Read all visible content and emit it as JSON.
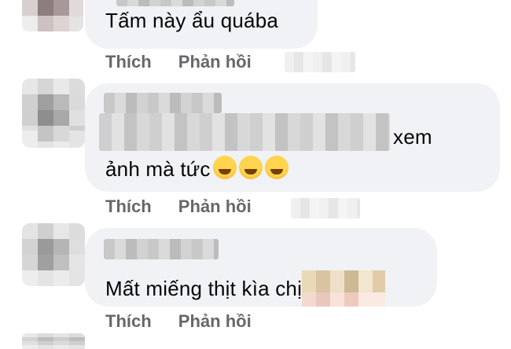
{
  "comments": [
    {
      "text": "Tấm này ẩu quába",
      "actions": {
        "like": "Thích",
        "reply": "Phản hồi"
      }
    },
    {
      "text_line1_suffix": "xem",
      "text_line2": "ảnh mà tức",
      "emojis": [
        "grinning-squinting-face",
        "grinning-squinting-face",
        "grinning-squinting-face"
      ],
      "actions": {
        "like": "Thích",
        "reply": "Phản hồi"
      }
    },
    {
      "text": "Mất miếng thịt kìa chị",
      "actions": {
        "like": "Thích",
        "reply": "Phản hồi"
      }
    }
  ],
  "colors": {
    "bubble": "#f0f2f5",
    "action_text": "#65676b",
    "comment_text": "#050505"
  }
}
